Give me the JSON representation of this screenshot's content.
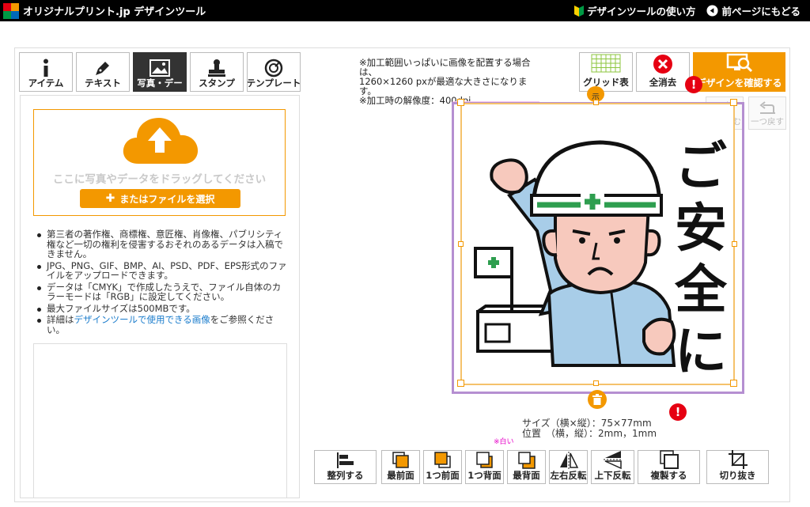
{
  "header": {
    "brand": "オリジナルプリント.jp デザインツール",
    "help_link": "デザインツールの使い方",
    "back_link": "前ページにもどる"
  },
  "tabs": [
    {
      "label": "アイテム",
      "icon": "info-icon"
    },
    {
      "label": "テキスト",
      "icon": "pen-icon"
    },
    {
      "label": "写真・デー",
      "icon": "photo-icon"
    },
    {
      "label": "スタンプ",
      "icon": "stamp-icon"
    },
    {
      "label": "テンプレート",
      "icon": "template-icon"
    }
  ],
  "upload": {
    "drop_hint": "ここに写真やデータをドラッグしてください",
    "file_button": "またはファイルを選択"
  },
  "notes": {
    "n1": "第三者の著作権、商標権、意匠権、肖像権、パブリシティ権など一切の権利を侵害するおそれのあるデータは入稿できません。",
    "n2": "JPG、PNG、GIF、BMP、AI、PSD、PDF、EPS形式のファイルをアップロードできます。",
    "n3": "データは「CMYK」で作成したうえで、ファイル自体のカラーモードは「RGB」に設定してください。",
    "n4": "最大ファイルサイズは500MBです。",
    "n5_prefix": "詳細は",
    "n5_link": "デザインツールで使用できる画像",
    "n5_suffix": "をご参照ください。"
  },
  "info": {
    "line1": "※加工範囲いっぱいに画像を配置する場合は、",
    "line2": "1260×1260 pxが最適な大きさになります。",
    "line3": "※加工時の解像度：400dpi"
  },
  "toolbar": {
    "grid": "グリッド表",
    "clear": "全消去",
    "confirm": "デザインを確認する",
    "redo": "一つ進む",
    "undo": "一つ戻す"
  },
  "canvas": {
    "rotate_label": "示",
    "slogan_1": "ご",
    "slogan_2": "安",
    "slogan_3": "全",
    "slogan_4": "に"
  },
  "size_info": {
    "size_line": "サイズ（横×縦）：75×77mm",
    "pos_line": "位置　（横，縦）：2mm，1mm",
    "pink_note": "※白い"
  },
  "bottom": {
    "align": "整列する",
    "front": "最前面",
    "forward": "1つ前面",
    "backward": "1つ背面",
    "back": "最背面",
    "flip_h": "左右反転",
    "flip_v": "上下反転",
    "duplicate": "複製する",
    "crop": "切り抜き"
  },
  "colors": {
    "accent": "#f39800",
    "warning": "#e60012",
    "canvas_border": "#b58fd1"
  }
}
